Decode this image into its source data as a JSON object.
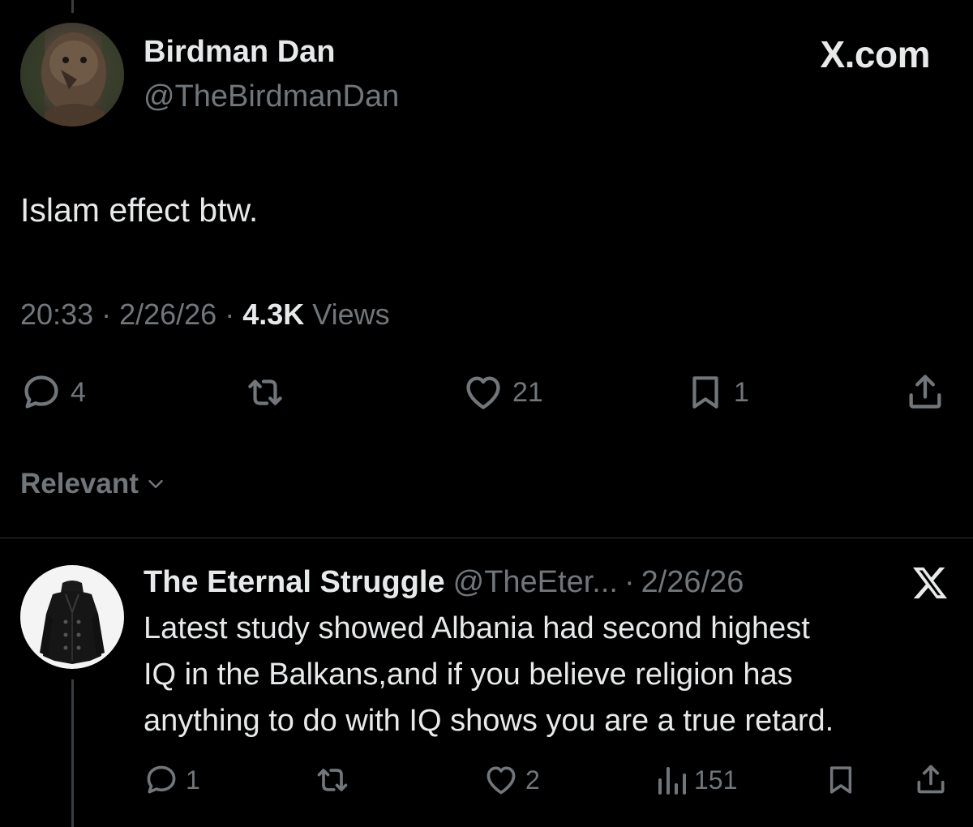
{
  "tweet": {
    "author_name": "Birdman Dan",
    "handle": "@TheBirdmanDan",
    "site_label": "X.com",
    "text": "Islam effect btw.",
    "time": "20:33",
    "date": "2/26/26",
    "views_count": "4.3K",
    "views_label": "Views",
    "meta_separator": "·",
    "actions": {
      "replies": "4",
      "likes": "21",
      "bookmarks": "1"
    }
  },
  "sort": {
    "label": "Relevant"
  },
  "reply": {
    "author_name": "The Eternal Struggle",
    "handle": "@TheEter...",
    "date": "2/26/26",
    "header_separator": "·",
    "text_lines": [
      "Latest study showed Albania had second highest",
      "IQ in the Balkans,and if you believe religion has",
      "anything to do with IQ shows you are a true retard."
    ],
    "actions": {
      "replies": "1",
      "likes": "2",
      "views": "151"
    }
  },
  "icons": {
    "reply": "reply-bubble-icon",
    "retweet": "retweet-icon",
    "like": "heart-icon",
    "bookmark": "bookmark-icon",
    "share": "share-icon",
    "views": "views-bar-chart-icon",
    "chevron": "chevron-down-icon",
    "x_logo": "x-logo-icon"
  },
  "colors": {
    "background": "#000000",
    "text_primary": "#e7e9ea",
    "text_secondary": "#71767b",
    "divider": "#2f3336"
  }
}
